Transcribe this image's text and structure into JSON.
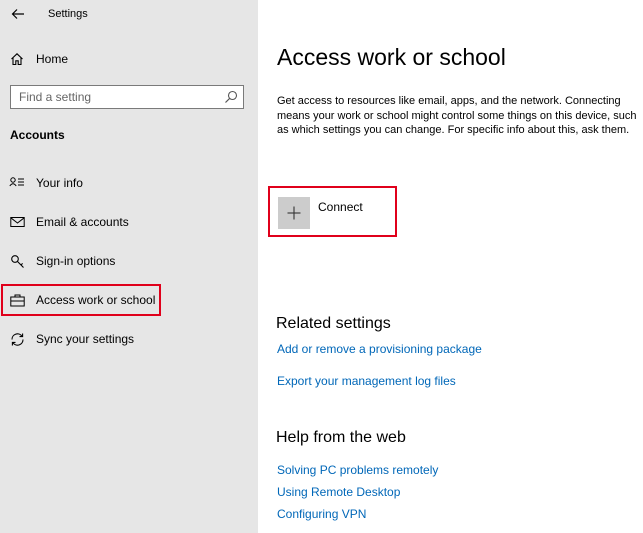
{
  "window": {
    "title": "Settings"
  },
  "sidebar": {
    "home_label": "Home",
    "search_placeholder": "Find a setting",
    "section_label": "Accounts",
    "items": [
      {
        "label": "Your info",
        "icon": "person-card-icon"
      },
      {
        "label": "Email & accounts",
        "icon": "envelope-icon"
      },
      {
        "label": "Sign-in options",
        "icon": "key-icon"
      },
      {
        "label": "Access work or school",
        "icon": "briefcase-icon",
        "selected": true
      },
      {
        "label": "Sync your settings",
        "icon": "sync-icon"
      }
    ]
  },
  "main": {
    "title": "Access work or school",
    "description": "Get access to resources like email, apps, and the network. Connecting means your work or school might control some things on this device, such as which settings you can change. For specific info about this, ask them.",
    "connect_label": "Connect",
    "related": {
      "heading": "Related settings",
      "links": [
        "Add or remove a provisioning package",
        "Export your management log files"
      ]
    },
    "help": {
      "heading": "Help from the web",
      "links": [
        "Solving PC problems remotely",
        "Using Remote Desktop",
        "Configuring VPN"
      ]
    }
  },
  "colors": {
    "sidebar_bg": "#e6e6e6",
    "link": "#0067b8",
    "highlight": "#e0001b",
    "connect_tile": "#cccccc"
  }
}
